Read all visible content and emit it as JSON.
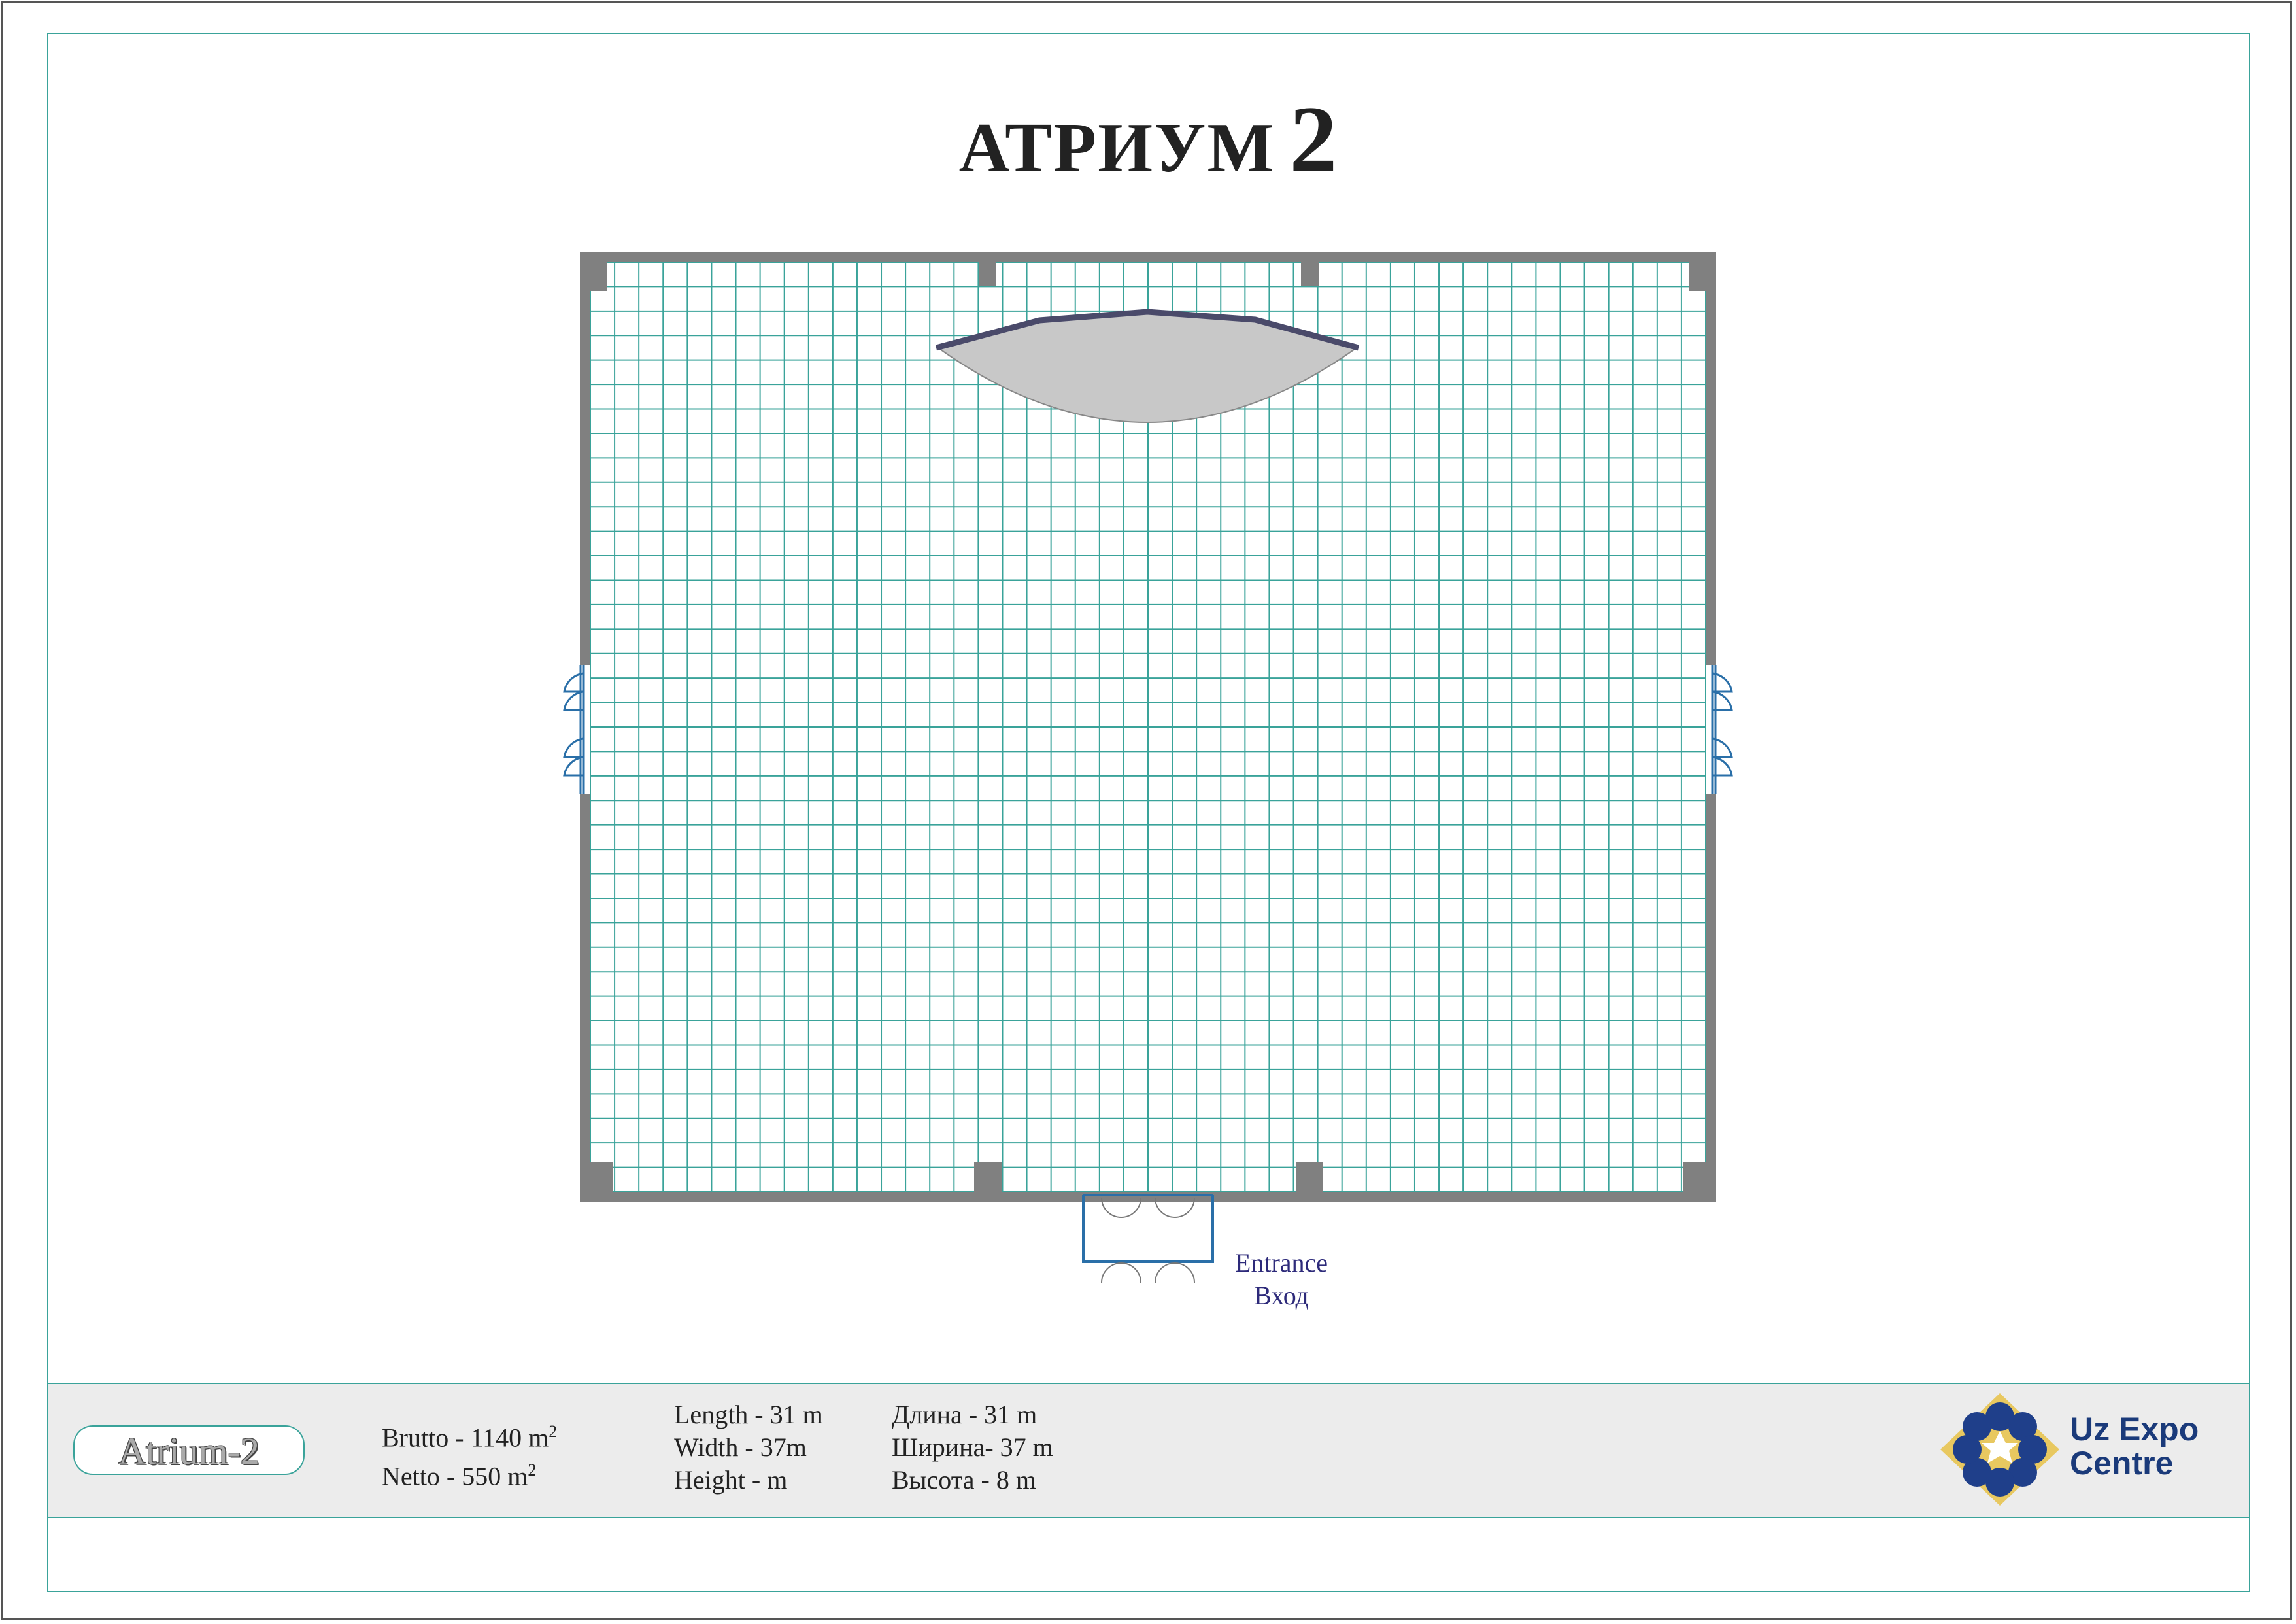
{
  "title": {
    "word": "АТРИУМ",
    "number": "2"
  },
  "hall_name": "Atrium-2",
  "area": {
    "brutto_label": "Brutto - 1140 m",
    "netto_label": "Netto  - 550 m",
    "unit_power": "2"
  },
  "dimensions_en": {
    "length": "Length - 31 m",
    "width": "Width   - 37m",
    "height": "Height  - m"
  },
  "dimensions_ru": {
    "length": "Длина   -  31 m",
    "width": "Ширина-  37  m",
    "height": "Высота  -  8 m"
  },
  "entrance": {
    "en": "Entrance",
    "ru": "Вход"
  },
  "logo": {
    "line1": "Uz Expo",
    "line2": "Centre"
  },
  "colors": {
    "grid": "#3aa39a",
    "wall": "#808080",
    "door": "#2a6fa8",
    "stage": "#c8c8c8",
    "stage_edge": "#4a4a6a",
    "label": "#2d2a7a",
    "logo_blue": "#1f3f8a",
    "logo_gold": "#e8c860"
  }
}
